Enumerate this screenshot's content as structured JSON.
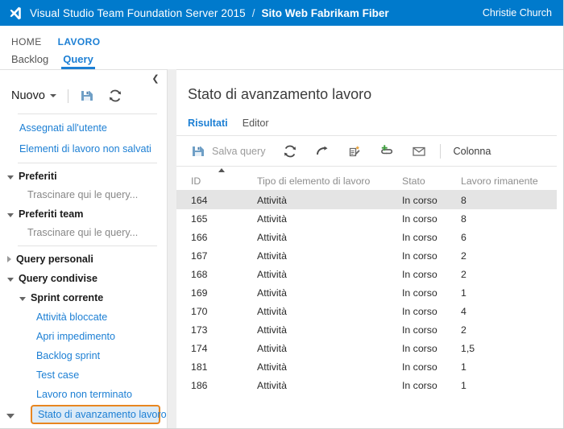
{
  "header": {
    "logo_icon": "visual-studio-logo",
    "brand": "Visual Studio Team Foundation Server 2015",
    "separator": "/",
    "project": "Sito Web Fabrikam Fiber",
    "user": "Christie Church",
    "accent_color": "#007acc"
  },
  "nav": {
    "primary": [
      {
        "label": "HOME",
        "active": false
      },
      {
        "label": "LAVORO",
        "active": true
      }
    ],
    "secondary": [
      {
        "label": "Backlog",
        "active": false
      },
      {
        "label": "Query",
        "active": true
      }
    ],
    "link_color": "#1c7fd4"
  },
  "sidebar": {
    "collapse_icon": "chevron-left-icon",
    "new_button": {
      "label": "Nuovo",
      "caret_icon": "chevron-down-icon"
    },
    "toolbar_icons": [
      {
        "name": "save-queries-icon"
      },
      {
        "name": "refresh-icon"
      }
    ],
    "links": [
      "Assegnati all'utente",
      "Elementi di lavoro non salvati"
    ],
    "groups": [
      {
        "label": "Preferiti",
        "expanded": true,
        "hint": "Trascinare qui le query..."
      },
      {
        "label": "Preferiti team",
        "expanded": true,
        "hint": "Trascinare qui le query..."
      }
    ],
    "personal_queries": {
      "label": "Query personali",
      "expanded": false
    },
    "shared_queries": {
      "label": "Query condivise",
      "expanded": true
    },
    "current_sprint": {
      "label": "Sprint corrente",
      "expanded": true
    },
    "sprint_items": [
      {
        "label": "Attività bloccate",
        "selected": false
      },
      {
        "label": "Apri impedimento",
        "selected": false
      },
      {
        "label": "Backlog sprint",
        "selected": false
      },
      {
        "label": "Test case",
        "selected": false
      },
      {
        "label": "Lavoro non terminato",
        "selected": false
      },
      {
        "label": "Stato di avanzamento lavoro",
        "selected": true
      }
    ],
    "selected_highlight_color": "#e88620",
    "scroll_down_icon": "caret-down-icon"
  },
  "main": {
    "title": "Stato di avanzamento lavoro",
    "tabs": [
      {
        "label": "Risultati",
        "active": true
      },
      {
        "label": "Editor",
        "active": false
      }
    ],
    "toolbar": {
      "save_icon": "save-query-icon",
      "save_label": "Salva query",
      "icons": [
        {
          "name": "refresh-icon"
        },
        {
          "name": "revert-arrow-icon"
        },
        {
          "name": "new-query-chart-icon"
        },
        {
          "name": "add-link-icon"
        },
        {
          "name": "email-icon"
        }
      ],
      "column_label": "Colonna"
    },
    "grid": {
      "sort_indicator": "sort-ascending-icon",
      "sort_column": "ID",
      "columns": [
        "ID",
        "Tipo di elemento di lavoro",
        "Stato",
        "Lavoro rimanente"
      ],
      "rows": [
        {
          "expander": "caret-down-icon",
          "id": "164",
          "type": "Attività",
          "state": "In corso",
          "remaining": "8",
          "selected": true
        },
        {
          "expander": "",
          "id": "165",
          "type": "Attività",
          "state": "In corso",
          "remaining": "8",
          "selected": false
        },
        {
          "expander": "",
          "id": "166",
          "type": "Attività",
          "state": "In corso",
          "remaining": "6",
          "selected": false
        },
        {
          "expander": "",
          "id": "167",
          "type": "Attività",
          "state": "In corso",
          "remaining": "2",
          "selected": false
        },
        {
          "expander": "",
          "id": "168",
          "type": "Attività",
          "state": "In corso",
          "remaining": "2",
          "selected": false
        },
        {
          "expander": "",
          "id": "169",
          "type": "Attività",
          "state": "In corso",
          "remaining": "1",
          "selected": false
        },
        {
          "expander": "",
          "id": "170",
          "type": "Attività",
          "state": "In corso",
          "remaining": "4",
          "selected": false
        },
        {
          "expander": "",
          "id": "173",
          "type": "Attività",
          "state": "In corso",
          "remaining": "2",
          "selected": false
        },
        {
          "expander": "",
          "id": "174",
          "type": "Attività",
          "state": "In corso",
          "remaining": "1,5",
          "selected": false
        },
        {
          "expander": "",
          "id": "181",
          "type": "Attività",
          "state": "In corso",
          "remaining": "1",
          "selected": false
        },
        {
          "expander": "",
          "id": "186",
          "type": "Attività",
          "state": "In corso",
          "remaining": "1",
          "selected": false
        }
      ]
    }
  }
}
